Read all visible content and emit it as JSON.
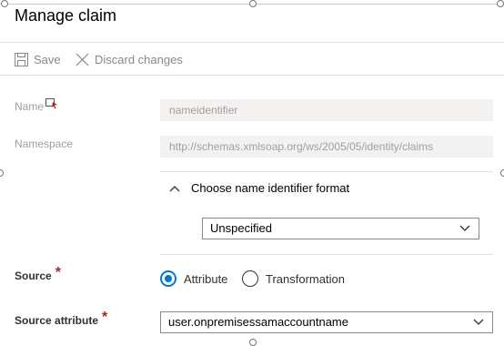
{
  "panel": {
    "title": "Manage claim"
  },
  "toolbar": {
    "save_label": "Save",
    "discard_label": "Discard changes"
  },
  "name_field": {
    "label": "Name",
    "value": "nameidentifier"
  },
  "namespace_field": {
    "label": "Namespace",
    "value": "http://schemas.xmlsoap.org/ws/2005/05/identity/claims"
  },
  "name_id_format": {
    "label": "Choose name identifier format",
    "selected": "Unspecified"
  },
  "source": {
    "label": "Source",
    "required_mark": "*",
    "options": [
      "Attribute",
      "Transformation"
    ],
    "selected": "Attribute"
  },
  "source_attribute": {
    "label": "Source attribute",
    "required_mark": "*",
    "selected": "user.onpremisessamaccountname"
  },
  "colors": {
    "accent": "#0078d4",
    "required": "#a4262c",
    "disabled_text": "#a19f9d",
    "readonly_bg": "#f3f2f1"
  }
}
